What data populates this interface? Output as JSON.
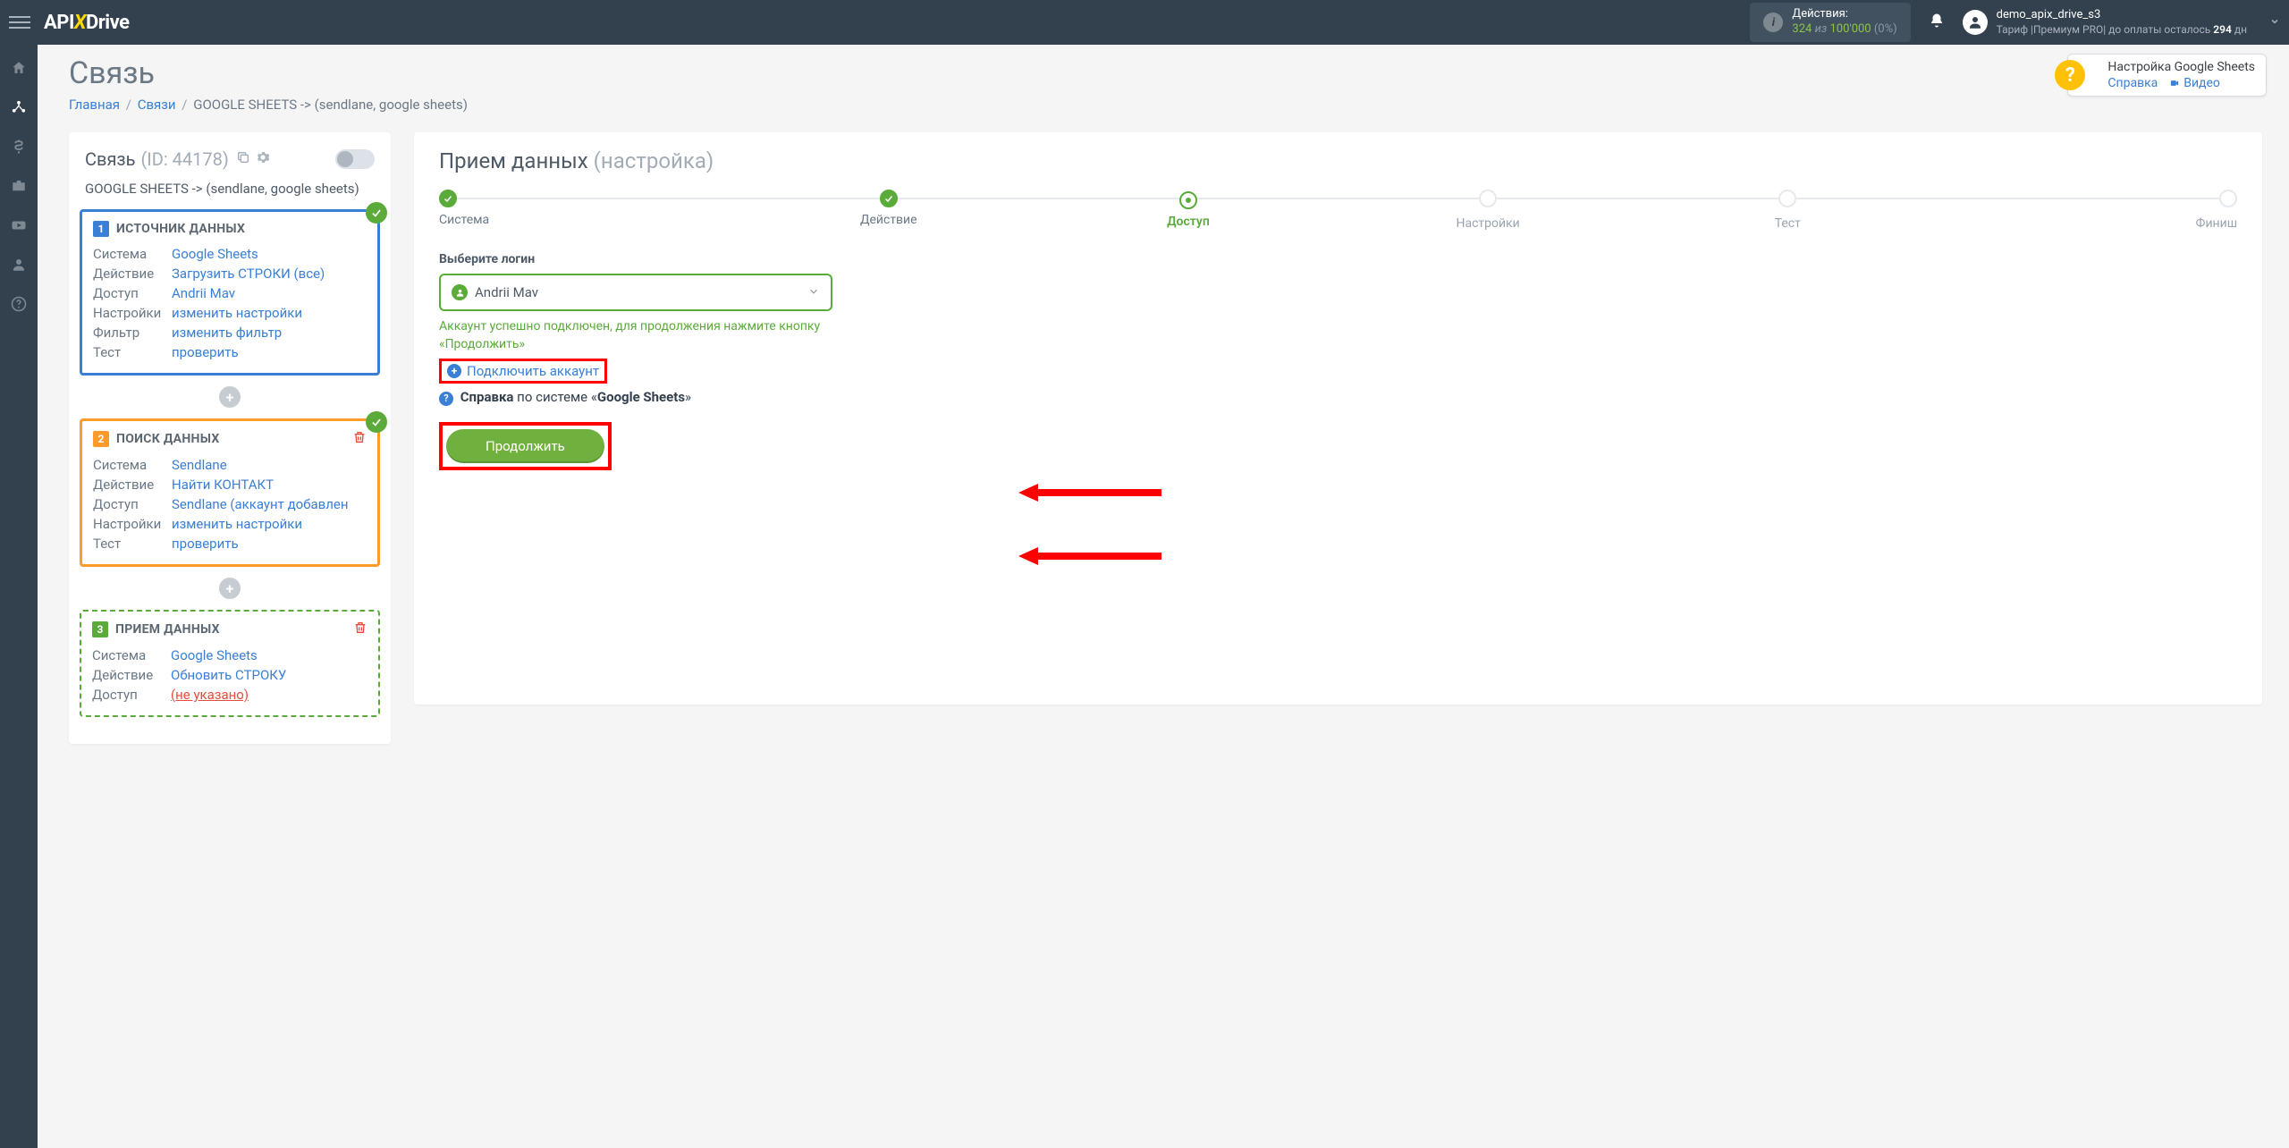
{
  "header": {
    "logo_pre": "API",
    "logo_x": "X",
    "logo_post": "Drive",
    "actions_label": "Действия:",
    "actions_count": "324",
    "actions_of": "из",
    "actions_total": "100'000",
    "actions_pct": "(0%)",
    "user_name": "demo_apix_drive_s3",
    "tariff_line_pre": "Тариф |Премиум PRO| до оплаты осталось ",
    "tariff_days": "294",
    "tariff_line_post": " дн"
  },
  "help_bubble": {
    "title": "Настройка Google Sheets",
    "help_link": "Справка",
    "video_link": "Видео"
  },
  "page": {
    "title": "Связь",
    "bc_home": "Главная",
    "bc_links": "Связи",
    "bc_current": "GOOGLE SHEETS -> (sendlane, google sheets)"
  },
  "left_panel": {
    "title": "Связь",
    "id_label": "(ID: 44178)",
    "sub": "GOOGLE SHEETS -> (sendlane, google sheets)",
    "labels": {
      "system": "Система",
      "action": "Действие",
      "access": "Доступ",
      "settings": "Настройки",
      "filter": "Фильтр",
      "test": "Тест"
    },
    "card1": {
      "title": "ИСТОЧНИК ДАННЫХ",
      "num": "1",
      "system": "Google Sheets",
      "action": "Загрузить СТРОКИ (все)",
      "access": "Andrii Mav",
      "settings": "изменить настройки",
      "filter": "изменить фильтр",
      "test": "проверить"
    },
    "card2": {
      "title": "ПОИСК ДАННЫХ",
      "num": "2",
      "system": "Sendlane",
      "action": "Найти КОНТАКТ",
      "access": "Sendlane (аккаунт добавлен",
      "settings": "изменить настройки",
      "test": "проверить"
    },
    "card3": {
      "title": "ПРИЕМ ДАННЫХ",
      "num": "3",
      "system": "Google Sheets",
      "action": "Обновить СТРОКУ",
      "access": "(не указано)"
    }
  },
  "right_panel": {
    "title": "Прием данных",
    "title_sub": "(настройка)",
    "steps": {
      "s1": "Система",
      "s2": "Действие",
      "s3": "Доступ",
      "s4": "Настройки",
      "s5": "Тест",
      "s6": "Финиш"
    },
    "select_label": "Выберите логин",
    "select_value": "Andrii Mav",
    "success": "Аккаунт успешно подключен, для продолжения нажмите кнопку «Продолжить»",
    "connect": "Подключить аккаунт",
    "help_pre": "Справка",
    "help_mid": " по системе «",
    "help_sys": "Google Sheets",
    "help_post": "»",
    "continue": "Продолжить"
  }
}
